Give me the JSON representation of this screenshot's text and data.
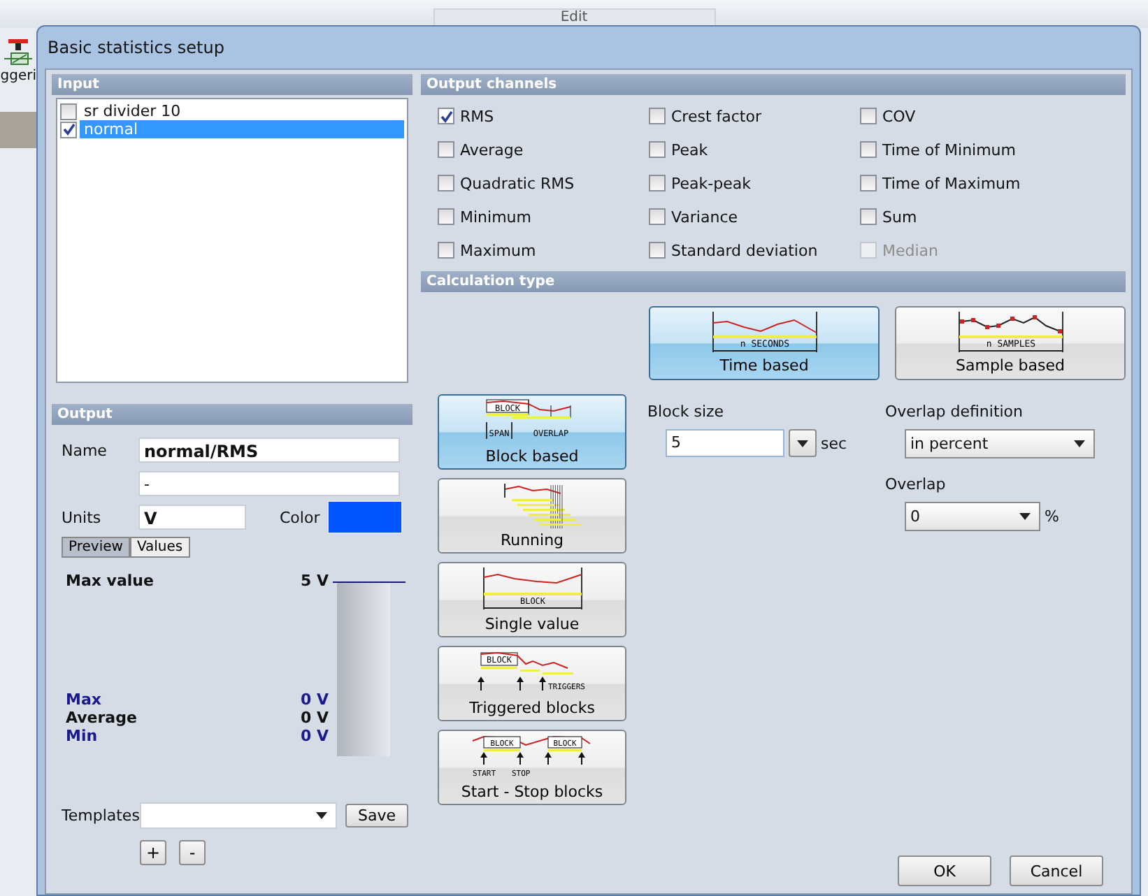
{
  "background_app": {
    "menu_tab": "Edit",
    "toolbar_label": "ggeri"
  },
  "window": {
    "title": "Basic statistics setup"
  },
  "input": {
    "title": "Input",
    "items": [
      {
        "label": "sr divider 10",
        "checked": false,
        "selected": false
      },
      {
        "label": "normal",
        "checked": true,
        "selected": true
      }
    ]
  },
  "output_channels": {
    "title": "Output channels",
    "columns": [
      [
        {
          "label": "RMS",
          "checked": true,
          "disabled": false
        },
        {
          "label": "Average",
          "checked": false,
          "disabled": false
        },
        {
          "label": "Quadratic RMS",
          "checked": false,
          "disabled": false
        },
        {
          "label": "Minimum",
          "checked": false,
          "disabled": false
        },
        {
          "label": "Maximum",
          "checked": false,
          "disabled": false
        }
      ],
      [
        {
          "label": "Crest factor",
          "checked": false,
          "disabled": false
        },
        {
          "label": "Peak",
          "checked": false,
          "disabled": false
        },
        {
          "label": "Peak-peak",
          "checked": false,
          "disabled": false
        },
        {
          "label": "Variance",
          "checked": false,
          "disabled": false
        },
        {
          "label": "Standard deviation",
          "checked": false,
          "disabled": false
        }
      ],
      [
        {
          "label": "COV",
          "checked": false,
          "disabled": false
        },
        {
          "label": "Time of Minimum",
          "checked": false,
          "disabled": false
        },
        {
          "label": "Time of Maximum",
          "checked": false,
          "disabled": false
        },
        {
          "label": "Sum",
          "checked": false,
          "disabled": false
        },
        {
          "label": "Median",
          "checked": false,
          "disabled": true
        }
      ]
    ]
  },
  "calculation_type": {
    "title": "Calculation type",
    "bases": [
      {
        "kind": "time",
        "label": "Time based",
        "diagram_labels": [
          "n SECONDS"
        ],
        "selected": true
      },
      {
        "kind": "sample",
        "label": "Sample based",
        "diagram_labels": [
          "n SAMPLES"
        ],
        "selected": false
      }
    ],
    "methods": [
      {
        "kind": "block",
        "label": "Block based",
        "diagram_labels": [
          "BLOCK",
          "SPAN",
          "OVERLAP"
        ],
        "selected": true
      },
      {
        "kind": "running",
        "label": "Running",
        "selected": false
      },
      {
        "kind": "single",
        "label": "Single value",
        "diagram_labels": [
          "BLOCK"
        ],
        "selected": false
      },
      {
        "kind": "triggered",
        "label": "Triggered blocks",
        "diagram_labels": [
          "BLOCK",
          "TRIGGERS"
        ],
        "selected": false
      },
      {
        "kind": "start_stop",
        "label": "Start - Stop blocks",
        "diagram_labels": [
          "BLOCK",
          "BLOCK",
          "START",
          "STOP"
        ],
        "selected": false
      }
    ],
    "block_size": {
      "label": "Block size",
      "value": "5",
      "unit": "sec"
    },
    "overlap_definition": {
      "label": "Overlap definition",
      "value": "in percent"
    },
    "overlap": {
      "label": "Overlap",
      "value": "0",
      "unit": "%"
    }
  },
  "output": {
    "title": "Output",
    "name_label": "Name",
    "name": "normal/RMS",
    "description": "-",
    "units_label": "Units",
    "units": "V",
    "color_label": "Color",
    "color": "#0055ff",
    "tabs": [
      {
        "label": "Preview",
        "selected": true
      },
      {
        "label": "Values",
        "selected": false
      }
    ],
    "preview": {
      "max_value_label": "Max value",
      "max_value": "5 V",
      "stats": [
        {
          "kind": "max",
          "label": "Max",
          "value": "0 V"
        },
        {
          "kind": "average",
          "label": "Average",
          "value": "0 V"
        },
        {
          "kind": "min",
          "label": "Min",
          "value": "0 V"
        }
      ]
    },
    "templates_label": "Templates",
    "save": "Save",
    "add": "+",
    "remove": "-"
  },
  "buttons": {
    "ok": "OK",
    "cancel": "Cancel"
  }
}
